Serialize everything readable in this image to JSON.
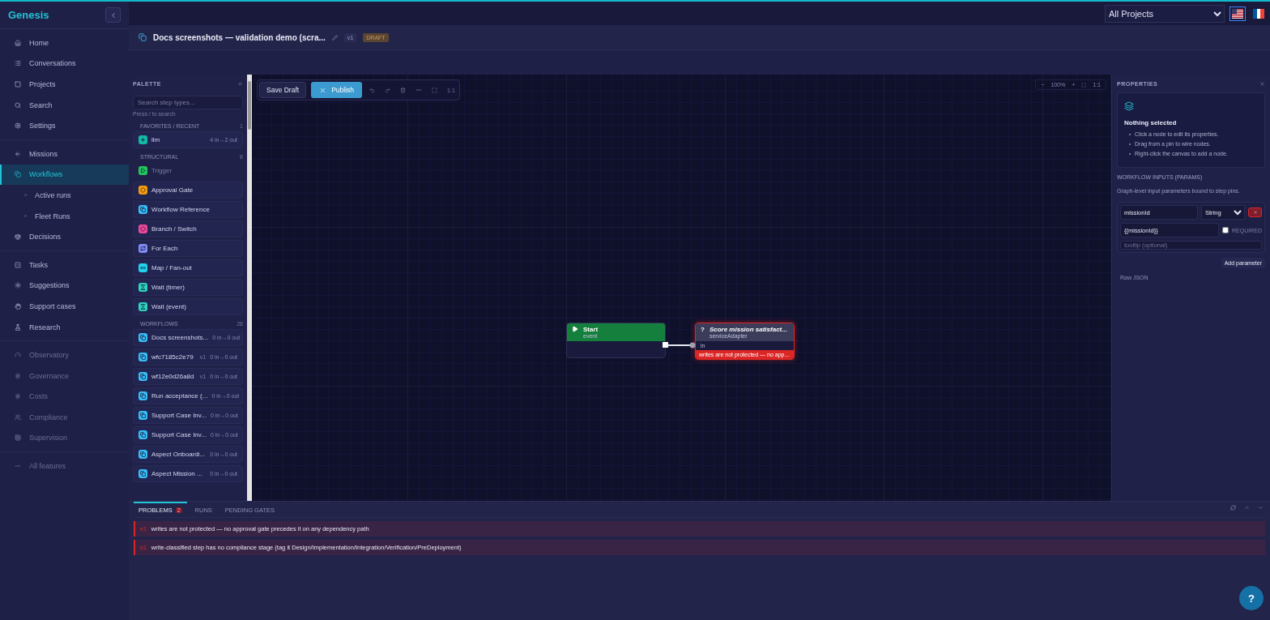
{
  "brand": "Genesis",
  "sidebar": {
    "sections": [
      {
        "items": [
          {
            "label": "Home",
            "kind": "nav",
            "selected": false,
            "disabled": false
          },
          {
            "label": "Conversations",
            "kind": "nav",
            "selected": false,
            "disabled": false
          },
          {
            "label": "Projects",
            "kind": "nav",
            "selected": false,
            "disabled": false
          },
          {
            "label": "Search",
            "kind": "nav",
            "selected": false,
            "disabled": false
          },
          {
            "label": "Settings",
            "kind": "nav",
            "selected": false,
            "disabled": false
          }
        ]
      },
      {
        "items": [
          {
            "label": "Missions",
            "kind": "nav",
            "selected": false,
            "disabled": false
          },
          {
            "label": "Workflows",
            "kind": "nav",
            "selected": true,
            "disabled": false
          },
          {
            "label": "Active runs",
            "kind": "sub",
            "selected": false,
            "disabled": false
          },
          {
            "label": "Fleet Runs",
            "kind": "sub",
            "selected": false,
            "disabled": false
          },
          {
            "label": "Decisions",
            "kind": "nav",
            "selected": false,
            "disabled": false
          }
        ]
      },
      {
        "items": [
          {
            "label": "Tasks",
            "kind": "nav",
            "selected": false,
            "disabled": false
          },
          {
            "label": "Suggestions",
            "kind": "nav",
            "selected": false,
            "disabled": false
          },
          {
            "label": "Support cases",
            "kind": "nav",
            "selected": false,
            "disabled": false
          },
          {
            "label": "Research",
            "kind": "nav",
            "selected": false,
            "disabled": false
          }
        ]
      },
      {
        "items": [
          {
            "label": "Observatory",
            "kind": "nav",
            "selected": false,
            "disabled": true
          },
          {
            "label": "Governance",
            "kind": "nav",
            "selected": false,
            "disabled": true
          },
          {
            "label": "Costs",
            "kind": "nav",
            "selected": false,
            "disabled": true
          },
          {
            "label": "Compliance",
            "kind": "nav",
            "selected": false,
            "disabled": true
          },
          {
            "label": "Supervision",
            "kind": "nav",
            "selected": false,
            "disabled": true
          }
        ]
      },
      {
        "items": [
          {
            "label": "All features",
            "kind": "more",
            "selected": false,
            "disabled": true
          }
        ]
      }
    ]
  },
  "topbar": {
    "project_select": "All Projects",
    "languages": [
      {
        "selected": true
      },
      {
        "selected": false
      }
    ]
  },
  "workflow": {
    "title": "Docs screenshots — validation demo (scra...",
    "version": "v1",
    "status": "DRAFT"
  },
  "palette": {
    "title": "PALETTE",
    "search_placeholder": "Search step types...",
    "hint": "Press / to search",
    "groups": [
      {
        "title": "FAVORITES / RECENT",
        "count": "1",
        "items": [
          {
            "label": "llm",
            "pins": "4 in→2 out",
            "color": "#14b8a6",
            "disabled": false
          }
        ]
      },
      {
        "title": "STRUCTURAL",
        "count": "8",
        "items": [
          {
            "label": "Trigger",
            "color": "#22c55e",
            "disabled": true
          },
          {
            "label": "Approval Gate",
            "color": "#f59e0b",
            "disabled": false
          },
          {
            "label": "Workflow Reference",
            "color": "#38bdf8",
            "disabled": false
          },
          {
            "label": "Branch / Switch",
            "color": "#ec4899",
            "disabled": false
          },
          {
            "label": "For Each",
            "color": "#818cf8",
            "disabled": false
          },
          {
            "label": "Map / Fan-out",
            "color": "#22d3ee",
            "disabled": false
          },
          {
            "label": "Wait (timer)",
            "color": "#2dd4bf",
            "disabled": false
          },
          {
            "label": "Wait (event)",
            "color": "#2dd4bf",
            "disabled": false
          }
        ]
      },
      {
        "title": "WORKFLOWS",
        "count": "28",
        "items": [
          {
            "label": "Docs screenshots...",
            "pins": "0 in→0 out",
            "color": "#38bdf8",
            "disabled": false
          },
          {
            "label": "wfc7185c2e79",
            "version": "v1",
            "pins": "0 in→0 out",
            "color": "#38bdf8",
            "disabled": false
          },
          {
            "label": "wf12e0d26a8d",
            "version": "v1",
            "pins": "0 in→0 out",
            "color": "#38bdf8",
            "disabled": false
          },
          {
            "label": "Run acceptance (...",
            "pins": "0 in→0 out",
            "color": "#38bdf8",
            "disabled": false
          },
          {
            "label": "Support Case Inv...",
            "pins": "0 in→0 out",
            "color": "#38bdf8",
            "disabled": false
          },
          {
            "label": "Support Case Inv...",
            "pins": "0 in→0 out",
            "color": "#38bdf8",
            "disabled": false
          },
          {
            "label": "Aspect Onboardi...",
            "pins": "0 in→0 out",
            "color": "#38bdf8",
            "disabled": false
          },
          {
            "label": "Aspect Mission ...",
            "pins": "0 in→0 out",
            "color": "#38bdf8",
            "disabled": false
          }
        ]
      }
    ]
  },
  "toolbar": {
    "save": "Save Draft",
    "publish": "Publish",
    "fit": "1:1"
  },
  "zoom": {
    "minus": "−",
    "level": "100%",
    "plus": "+",
    "reset": "1:1"
  },
  "nodes": [
    {
      "kind": "start",
      "title": "Start",
      "subtitle": "event"
    },
    {
      "kind": "step",
      "icon": "?",
      "title": "Score mission satisfact...",
      "subtitle": "serviceAdapter",
      "pin": "in",
      "error": "writes are not protected — no app..."
    }
  ],
  "properties": {
    "title": "PROPERTIES",
    "empty_title": "Nothing selected",
    "tips": [
      "Click a node to edit its properties.",
      "Drag from a pin to wire nodes.",
      "Right-click the canvas to add a node."
    ],
    "inputs_title": "WORKFLOW INPUTS (PARAMS)",
    "inputs_help": "Graph-level input parameters bound to step pins.",
    "params": [
      {
        "name": "missionId",
        "type": "String",
        "default": "{{missionId}}",
        "required": false,
        "tooltip_placeholder": "tooltip (optional)"
      }
    ],
    "required_label": "REQUIRED",
    "add": "Add parameter",
    "raw": "Raw JSON"
  },
  "bottom": {
    "tabs": [
      {
        "label": "PROBLEMS",
        "count": "2",
        "selected": true
      },
      {
        "label": "RUNS",
        "selected": false
      },
      {
        "label": "PENDING GATES",
        "selected": false
      }
    ],
    "problems": [
      {
        "code": "e1",
        "message": "writes are not protected — no approval gate precedes it on any dependency path"
      },
      {
        "code": "e1",
        "message": "write-classified step has no compliance stage (tag it Design/Implementation/Integration/Verification/PreDeployment)"
      }
    ]
  },
  "help": "?"
}
